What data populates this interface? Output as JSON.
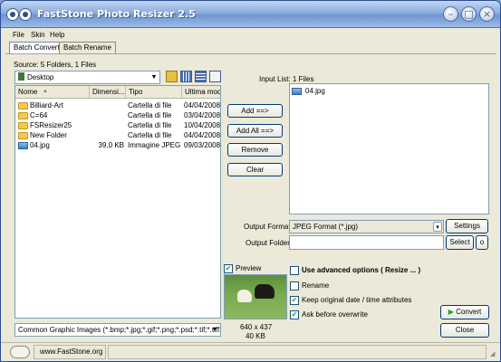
{
  "window": {
    "title": "FastStone Photo Resizer 2.5"
  },
  "menu": {
    "items": [
      "File",
      "Skin",
      "Help"
    ]
  },
  "tabs": [
    "Batch Convert",
    "Batch Rename"
  ],
  "source": {
    "label": "Source: 5 Folders, 1 Files",
    "location": "Desktop"
  },
  "file_list": {
    "columns": [
      "Nome",
      "Dimensi...",
      "Tipo",
      "Ultima modifi"
    ],
    "rows": [
      {
        "icon": "folder-icon",
        "name": "Billiard-Art",
        "size": "",
        "type": "Cartella di file",
        "modified": "04/04/2008"
      },
      {
        "icon": "folder-icon",
        "name": "C=64",
        "size": "",
        "type": "Cartella di file",
        "modified": "03/04/2008"
      },
      {
        "icon": "folder-icon",
        "name": "FSResizer25",
        "size": "",
        "type": "Cartella di file",
        "modified": "10/04/2008"
      },
      {
        "icon": "folder-icon",
        "name": "New Folder",
        "size": "",
        "type": "Cartella di file",
        "modified": "04/04/2008"
      },
      {
        "icon": "jpg-file-icon",
        "name": "04.jpg",
        "size": "39,0 KB",
        "type": "Immagine JPEG",
        "modified": "09/03/2008"
      }
    ]
  },
  "filter": {
    "value": "Common Graphic Images (*.bmp;*.jpg;*.gif;*.png;*.psd;*.tif;*.tiff;*.pc"
  },
  "mid_buttons": {
    "add": "Add ==>",
    "add_all": "Add All ==>",
    "remove": "Remove",
    "clear": "Clear"
  },
  "input_list": {
    "label": "Input List: 1 Files",
    "items": [
      "04.jpg"
    ]
  },
  "output": {
    "format_label": "Output Format:",
    "format_value": "JPEG Format (*.jpg)",
    "settings": "Settings",
    "folder_label": "Output Folder:",
    "folder_value": "",
    "select": "Select",
    "open_folder": "o"
  },
  "preview": {
    "label": "Preview",
    "checked": true,
    "dimensions": "640 x 437",
    "size": "40 KB"
  },
  "options": {
    "advanced": {
      "label": "Use advanced options ( Resize ... )",
      "checked": false
    },
    "rename": {
      "label": "Rename",
      "checked": false
    },
    "keep_date": {
      "label": "Keep original date / time attributes",
      "checked": true
    },
    "ask_overwrite": {
      "label": "Ask before overwrite",
      "checked": true
    }
  },
  "actions": {
    "convert": "Convert",
    "close": "Close"
  },
  "status": {
    "url": "www.FastStone.org"
  },
  "colors": {
    "titlebar": "#7fa2d4",
    "convert_arrow": "#21a121"
  }
}
